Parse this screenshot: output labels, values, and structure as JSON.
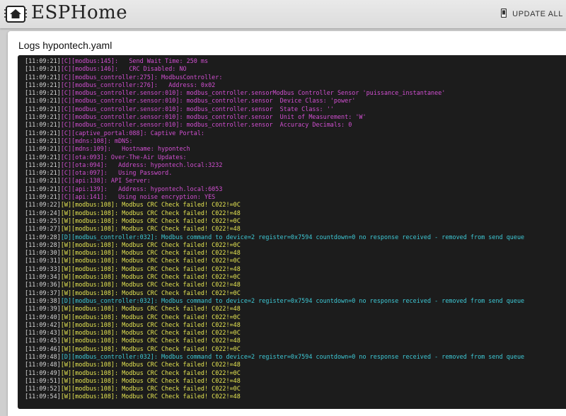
{
  "header": {
    "brand": "ESPHome",
    "update_all_label": "UPDATE ALL",
    "logo_icon": "esphome-house-chip-icon",
    "update_icon": "phone-update-icon"
  },
  "dialog": {
    "title": "Logs hypontech.yaml"
  },
  "colors": {
    "config_level": "#d14fd1",
    "warning_level": "#e5e552",
    "debug_level": "#3ec9d6",
    "log_background": "#1c1c1c"
  },
  "log_lines": [
    {
      "ts": "[11:09:21]",
      "level": "C",
      "text": "[C][modbus:145]:   Send Wait Time: 250 ms"
    },
    {
      "ts": "[11:09:21]",
      "level": "C",
      "text": "[C][modbus:146]:   CRC Disabled: NO"
    },
    {
      "ts": "[11:09:21]",
      "level": "C",
      "text": "[C][modbus_controller:275]: ModbusController:"
    },
    {
      "ts": "[11:09:21]",
      "level": "C",
      "text": "[C][modbus_controller:276]:   Address: 0x02"
    },
    {
      "ts": "[11:09:21]",
      "level": "C",
      "text": "[C][modbus_controller.sensor:010]: modbus_controller.sensorModbus Controller Sensor 'puissance_instantanee'"
    },
    {
      "ts": "[11:09:21]",
      "level": "C",
      "text": "[C][modbus_controller.sensor:010]: modbus_controller.sensor  Device Class: 'power'"
    },
    {
      "ts": "[11:09:21]",
      "level": "C",
      "text": "[C][modbus_controller.sensor:010]: modbus_controller.sensor  State Class: ''"
    },
    {
      "ts": "[11:09:21]",
      "level": "C",
      "text": "[C][modbus_controller.sensor:010]: modbus_controller.sensor  Unit of Measurement: 'W'"
    },
    {
      "ts": "[11:09:21]",
      "level": "C",
      "text": "[C][modbus_controller.sensor:010]: modbus_controller.sensor  Accuracy Decimals: 0"
    },
    {
      "ts": "[11:09:21]",
      "level": "C",
      "text": "[C][captive_portal:088]: Captive Portal:"
    },
    {
      "ts": "[11:09:21]",
      "level": "C",
      "text": "[C][mdns:108]: mDNS:"
    },
    {
      "ts": "[11:09:21]",
      "level": "C",
      "text": "[C][mdns:109]:   Hostname: hypontech"
    },
    {
      "ts": "[11:09:21]",
      "level": "C",
      "text": "[C][ota:093]: Over-The-Air Updates:"
    },
    {
      "ts": "[11:09:21]",
      "level": "C",
      "text": "[C][ota:094]:   Address: hypontech.local:3232"
    },
    {
      "ts": "[11:09:21]",
      "level": "C",
      "text": "[C][ota:097]:   Using Password."
    },
    {
      "ts": "[11:09:21]",
      "level": "C",
      "text": "[C][api:138]: API Server:"
    },
    {
      "ts": "[11:09:21]",
      "level": "C",
      "text": "[C][api:139]:   Address: hypontech.local:6053"
    },
    {
      "ts": "[11:09:21]",
      "level": "C",
      "text": "[C][api:141]:   Using noise encryption: YES"
    },
    {
      "ts": "[11:09:22]",
      "level": "W",
      "text": "[W][modbus:108]: Modbus CRC Check failed! C022!=0C"
    },
    {
      "ts": "[11:09:24]",
      "level": "W",
      "text": "[W][modbus:108]: Modbus CRC Check failed! C022!=48"
    },
    {
      "ts": "[11:09:25]",
      "level": "W",
      "text": "[W][modbus:108]: Modbus CRC Check failed! C022!=0C"
    },
    {
      "ts": "[11:09:27]",
      "level": "W",
      "text": "[W][modbus:108]: Modbus CRC Check failed! C022!=48"
    },
    {
      "ts": "[11:09:28]",
      "level": "D",
      "text": "[D][modbus_controller:032]: Modbus command to device=2 register=0x7594 countdown=0 no response received - removed from send queue"
    },
    {
      "ts": "[11:09:28]",
      "level": "W",
      "text": "[W][modbus:108]: Modbus CRC Check failed! C022!=0C"
    },
    {
      "ts": "[11:09:30]",
      "level": "W",
      "text": "[W][modbus:108]: Modbus CRC Check failed! C022!=48"
    },
    {
      "ts": "[11:09:31]",
      "level": "W",
      "text": "[W][modbus:108]: Modbus CRC Check failed! C022!=0C"
    },
    {
      "ts": "[11:09:33]",
      "level": "W",
      "text": "[W][modbus:108]: Modbus CRC Check failed! C022!=48"
    },
    {
      "ts": "[11:09:34]",
      "level": "W",
      "text": "[W][modbus:108]: Modbus CRC Check failed! C022!=0C"
    },
    {
      "ts": "[11:09:36]",
      "level": "W",
      "text": "[W][modbus:108]: Modbus CRC Check failed! C022!=48"
    },
    {
      "ts": "[11:09:37]",
      "level": "W",
      "text": "[W][modbus:108]: Modbus CRC Check failed! C022!=0C"
    },
    {
      "ts": "[11:09:38]",
      "level": "D",
      "text": "[D][modbus_controller:032]: Modbus command to device=2 register=0x7594 countdown=0 no response received - removed from send queue"
    },
    {
      "ts": "[11:09:39]",
      "level": "W",
      "text": "[W][modbus:108]: Modbus CRC Check failed! C022!=48"
    },
    {
      "ts": "[11:09:40]",
      "level": "W",
      "text": "[W][modbus:108]: Modbus CRC Check failed! C022!=0C"
    },
    {
      "ts": "[11:09:42]",
      "level": "W",
      "text": "[W][modbus:108]: Modbus CRC Check failed! C022!=48"
    },
    {
      "ts": "[11:09:43]",
      "level": "W",
      "text": "[W][modbus:108]: Modbus CRC Check failed! C022!=0C"
    },
    {
      "ts": "[11:09:45]",
      "level": "W",
      "text": "[W][modbus:108]: Modbus CRC Check failed! C022!=48"
    },
    {
      "ts": "[11:09:46]",
      "level": "W",
      "text": "[W][modbus:108]: Modbus CRC Check failed! C022!=0C"
    },
    {
      "ts": "[11:09:48]",
      "level": "D",
      "text": "[D][modbus_controller:032]: Modbus command to device=2 register=0x7594 countdown=0 no response received - removed from send queue"
    },
    {
      "ts": "[11:09:48]",
      "level": "W",
      "text": "[W][modbus:108]: Modbus CRC Check failed! C022!=48"
    },
    {
      "ts": "[11:09:49]",
      "level": "W",
      "text": "[W][modbus:108]: Modbus CRC Check failed! C022!=0C"
    },
    {
      "ts": "[11:09:51]",
      "level": "W",
      "text": "[W][modbus:108]: Modbus CRC Check failed! C022!=48"
    },
    {
      "ts": "[11:09:52]",
      "level": "W",
      "text": "[W][modbus:108]: Modbus CRC Check failed! C022!=0C"
    },
    {
      "ts": "[11:09:54]",
      "level": "W",
      "text": "[W][modbus:108]: Modbus CRC Check failed! C022!=48"
    }
  ]
}
